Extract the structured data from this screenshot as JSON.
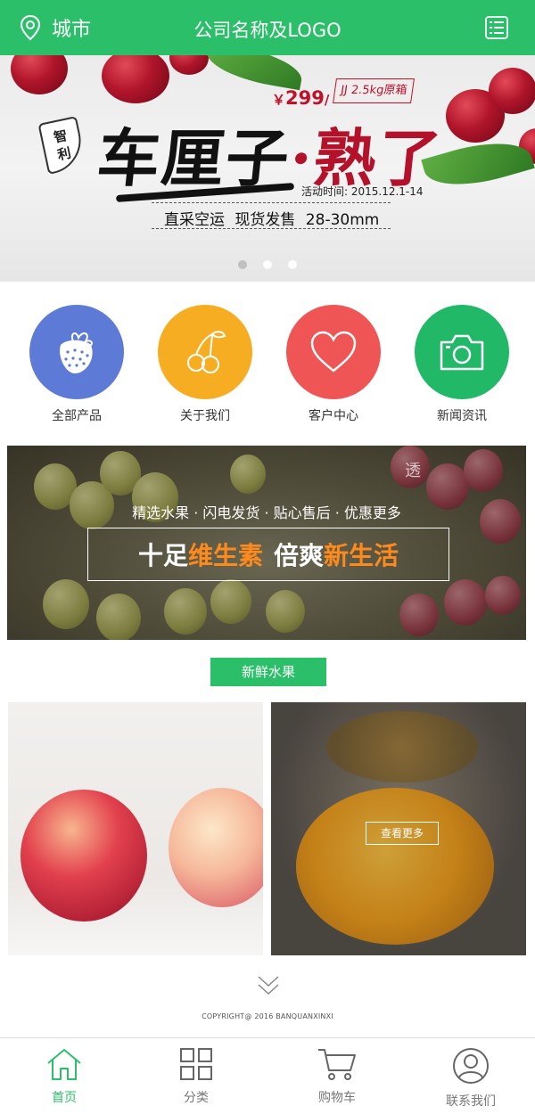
{
  "header": {
    "city_label": "城市",
    "title": "公司名称及LOGO"
  },
  "banner": {
    "price_prefix": "￥",
    "price": "299",
    "price_unit": "/",
    "tag": "JJ 2.5kg原箱",
    "badge_line1": "智",
    "badge_line2": "利",
    "headline_a": "车厘子",
    "headline_dot": "·",
    "headline_b": "熟了",
    "date": "活动时间: 2015.12.1-14",
    "sub": "直采空运  现货发售  28-30mm",
    "slides": 3,
    "active_slide": 1
  },
  "categories": [
    {
      "label": "全部产品",
      "icon": "strawberry-icon",
      "color": "#5c7ad6"
    },
    {
      "label": "关于我们",
      "icon": "cherry-icon",
      "color": "#f7ad22"
    },
    {
      "label": "客户中心",
      "icon": "heart-icon",
      "color": "#f05556"
    },
    {
      "label": "新闻资讯",
      "icon": "camera-icon",
      "color": "#21b868"
    }
  ],
  "promo": {
    "corner": "透",
    "line1": "精选水果 · 闪电发货 · 贴心售后 · 优惠更多",
    "slogan_a": "十足",
    "slogan_b": "维生素",
    "slogan_c": "倍爽",
    "slogan_d": "新生活"
  },
  "section": {
    "title": "新鲜水果"
  },
  "products": {
    "more_label": "查看更多"
  },
  "footer": {
    "copyright": "COPYRIGHT@ 2016    BANQUANXINXI"
  },
  "tabbar": [
    {
      "label": "首页",
      "icon": "home-icon",
      "active": true
    },
    {
      "label": "分类",
      "icon": "grid-icon",
      "active": false
    },
    {
      "label": "购物车",
      "icon": "cart-icon",
      "active": false
    },
    {
      "label": "联系我们",
      "icon": "user-icon",
      "active": false
    }
  ],
  "colors": {
    "brand_green": "#2bbf6a",
    "accent_orange": "#ff8a1c",
    "banner_red": "#c0102a"
  }
}
